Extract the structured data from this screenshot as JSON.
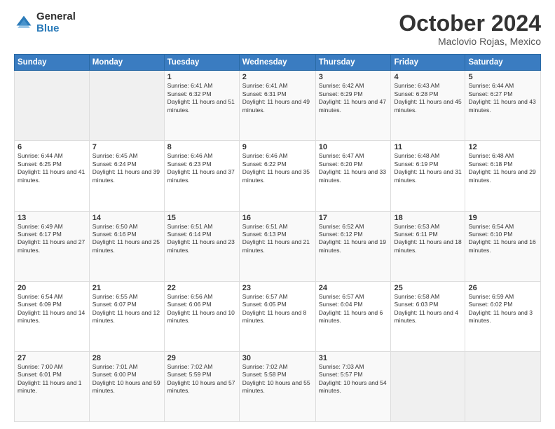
{
  "logo": {
    "general": "General",
    "blue": "Blue"
  },
  "header": {
    "month": "October 2024",
    "location": "Maclovio Rojas, Mexico"
  },
  "weekdays": [
    "Sunday",
    "Monday",
    "Tuesday",
    "Wednesday",
    "Thursday",
    "Friday",
    "Saturday"
  ],
  "weeks": [
    [
      {
        "day": "",
        "info": ""
      },
      {
        "day": "",
        "info": ""
      },
      {
        "day": "1",
        "info": "Sunrise: 6:41 AM\nSunset: 6:32 PM\nDaylight: 11 hours and 51 minutes."
      },
      {
        "day": "2",
        "info": "Sunrise: 6:41 AM\nSunset: 6:31 PM\nDaylight: 11 hours and 49 minutes."
      },
      {
        "day": "3",
        "info": "Sunrise: 6:42 AM\nSunset: 6:29 PM\nDaylight: 11 hours and 47 minutes."
      },
      {
        "day": "4",
        "info": "Sunrise: 6:43 AM\nSunset: 6:28 PM\nDaylight: 11 hours and 45 minutes."
      },
      {
        "day": "5",
        "info": "Sunrise: 6:44 AM\nSunset: 6:27 PM\nDaylight: 11 hours and 43 minutes."
      }
    ],
    [
      {
        "day": "6",
        "info": "Sunrise: 6:44 AM\nSunset: 6:25 PM\nDaylight: 11 hours and 41 minutes."
      },
      {
        "day": "7",
        "info": "Sunrise: 6:45 AM\nSunset: 6:24 PM\nDaylight: 11 hours and 39 minutes."
      },
      {
        "day": "8",
        "info": "Sunrise: 6:46 AM\nSunset: 6:23 PM\nDaylight: 11 hours and 37 minutes."
      },
      {
        "day": "9",
        "info": "Sunrise: 6:46 AM\nSunset: 6:22 PM\nDaylight: 11 hours and 35 minutes."
      },
      {
        "day": "10",
        "info": "Sunrise: 6:47 AM\nSunset: 6:20 PM\nDaylight: 11 hours and 33 minutes."
      },
      {
        "day": "11",
        "info": "Sunrise: 6:48 AM\nSunset: 6:19 PM\nDaylight: 11 hours and 31 minutes."
      },
      {
        "day": "12",
        "info": "Sunrise: 6:48 AM\nSunset: 6:18 PM\nDaylight: 11 hours and 29 minutes."
      }
    ],
    [
      {
        "day": "13",
        "info": "Sunrise: 6:49 AM\nSunset: 6:17 PM\nDaylight: 11 hours and 27 minutes."
      },
      {
        "day": "14",
        "info": "Sunrise: 6:50 AM\nSunset: 6:16 PM\nDaylight: 11 hours and 25 minutes."
      },
      {
        "day": "15",
        "info": "Sunrise: 6:51 AM\nSunset: 6:14 PM\nDaylight: 11 hours and 23 minutes."
      },
      {
        "day": "16",
        "info": "Sunrise: 6:51 AM\nSunset: 6:13 PM\nDaylight: 11 hours and 21 minutes."
      },
      {
        "day": "17",
        "info": "Sunrise: 6:52 AM\nSunset: 6:12 PM\nDaylight: 11 hours and 19 minutes."
      },
      {
        "day": "18",
        "info": "Sunrise: 6:53 AM\nSunset: 6:11 PM\nDaylight: 11 hours and 18 minutes."
      },
      {
        "day": "19",
        "info": "Sunrise: 6:54 AM\nSunset: 6:10 PM\nDaylight: 11 hours and 16 minutes."
      }
    ],
    [
      {
        "day": "20",
        "info": "Sunrise: 6:54 AM\nSunset: 6:09 PM\nDaylight: 11 hours and 14 minutes."
      },
      {
        "day": "21",
        "info": "Sunrise: 6:55 AM\nSunset: 6:07 PM\nDaylight: 11 hours and 12 minutes."
      },
      {
        "day": "22",
        "info": "Sunrise: 6:56 AM\nSunset: 6:06 PM\nDaylight: 11 hours and 10 minutes."
      },
      {
        "day": "23",
        "info": "Sunrise: 6:57 AM\nSunset: 6:05 PM\nDaylight: 11 hours and 8 minutes."
      },
      {
        "day": "24",
        "info": "Sunrise: 6:57 AM\nSunset: 6:04 PM\nDaylight: 11 hours and 6 minutes."
      },
      {
        "day": "25",
        "info": "Sunrise: 6:58 AM\nSunset: 6:03 PM\nDaylight: 11 hours and 4 minutes."
      },
      {
        "day": "26",
        "info": "Sunrise: 6:59 AM\nSunset: 6:02 PM\nDaylight: 11 hours and 3 minutes."
      }
    ],
    [
      {
        "day": "27",
        "info": "Sunrise: 7:00 AM\nSunset: 6:01 PM\nDaylight: 11 hours and 1 minute."
      },
      {
        "day": "28",
        "info": "Sunrise: 7:01 AM\nSunset: 6:00 PM\nDaylight: 10 hours and 59 minutes."
      },
      {
        "day": "29",
        "info": "Sunrise: 7:02 AM\nSunset: 5:59 PM\nDaylight: 10 hours and 57 minutes."
      },
      {
        "day": "30",
        "info": "Sunrise: 7:02 AM\nSunset: 5:58 PM\nDaylight: 10 hours and 55 minutes."
      },
      {
        "day": "31",
        "info": "Sunrise: 7:03 AM\nSunset: 5:57 PM\nDaylight: 10 hours and 54 minutes."
      },
      {
        "day": "",
        "info": ""
      },
      {
        "day": "",
        "info": ""
      }
    ]
  ]
}
